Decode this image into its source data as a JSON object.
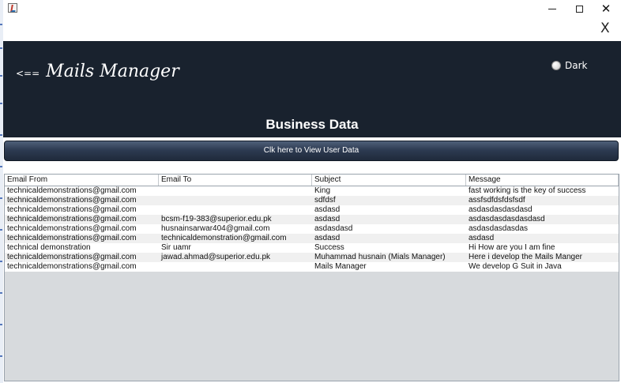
{
  "window": {
    "app_icon": "java-icon",
    "controls": [
      "minimize",
      "maximize",
      "close"
    ],
    "close_glyph": "✕",
    "inner_close": "X"
  },
  "header": {
    "back_arrow": "<==",
    "title": "Mails Manager",
    "theme_toggle_label": "Dark",
    "section_title": "Business Data"
  },
  "view_button_label": "Clk here to View User Data",
  "table": {
    "columns": [
      "Email From",
      "Email To",
      "Subject",
      "Message"
    ],
    "rows": [
      [
        "technicaldemonstrations@gmail.com",
        "",
        "King",
        "fast working is the key of success"
      ],
      [
        "technicaldemonstrations@gmail.com",
        "",
        "sdfdsf",
        "assfsdfdsfdsfsdf"
      ],
      [
        "technicaldemonstrations@gmail.com",
        "",
        "asdasd",
        "asdasdasdasdasd"
      ],
      [
        "technicaldemonstrations@gmail.com",
        "bcsm-f19-383@superior.edu.pk",
        "asdasd",
        "asdasdasdasdasdasd"
      ],
      [
        "technicaldemonstrations@gmail.com",
        "husnainsarwar404@gmail.com",
        "asdasdasd",
        "asdasdasdasdas"
      ],
      [
        "technicaldemonstrations@gmail.com",
        "technicaldemonstration@gmail.com",
        "asdasd",
        "asdasd"
      ],
      [
        "technical demonstration",
        "Sir uamr",
        "Success",
        "Hi How are you I am fine"
      ],
      [
        "technicaldemonstrations@gmail.com",
        "jawad.ahmad@superior.edu.pk",
        "Muhammad husnain (Mials Manager)",
        "Here i develop the Mails Manger"
      ],
      [
        "technicaldemonstrations@gmail.com",
        "",
        "Mails Manager",
        "We develop G Suit in Java"
      ]
    ]
  },
  "colors": {
    "header_bg": "#19222e",
    "button_bg": "#2d3b52",
    "table_empty_bg": "#d7dadd"
  }
}
